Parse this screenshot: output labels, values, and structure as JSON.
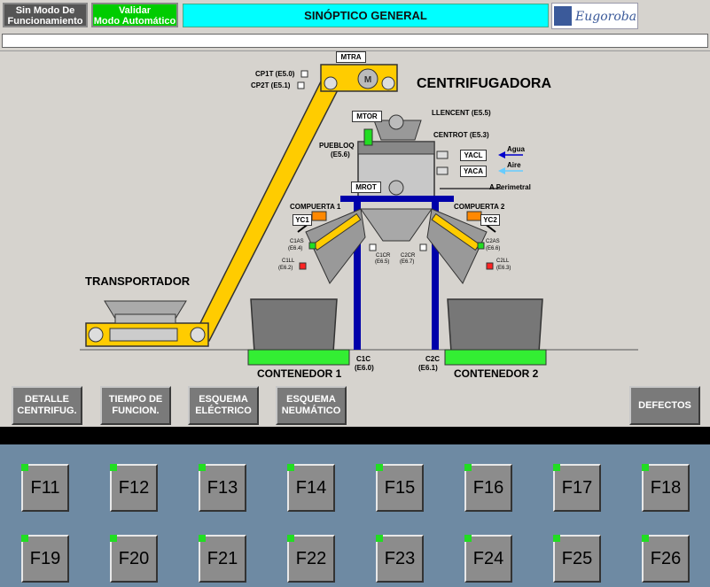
{
  "header": {
    "mode_button": "Sin Modo De\nFuncionamiento",
    "validate_button": "Validar\nModo Automático",
    "title": "SINÓPTICO GENERAL",
    "logo_text": "Eugoroba"
  },
  "synoptic": {
    "centrifuge_title": "CENTRIFUGADORA",
    "conveyor_title": "TRANSPORTADOR",
    "container1": "CONTENEDOR 1",
    "container2": "CONTENEDOR 2",
    "tags": {
      "mtra": "MTRA",
      "mtor": "MTOR",
      "mrot": "MROT",
      "yacl": "YACL",
      "yaca": "YACA",
      "yc1": "YC1",
      "yc2": "YC2",
      "motor_symbol": "M"
    },
    "signals": {
      "cp1t": "CP1T (E5.0)",
      "cp2t": "CP2T (E5.1)",
      "llencent": "LLENCENT (E5.5)",
      "centrot": "CENTROT (E5.3)",
      "puebloq": "PUEBLOQ",
      "puebloq_addr": "(E5.6)",
      "agua": "Agua",
      "aire": "Aire",
      "perimetral": "A Perimetral",
      "compuerta1": "COMPUERTA 1",
      "compuerta2": "COMPUERTA 2",
      "c1as": "C1AS",
      "c1as_addr": "(E6.4)",
      "c1ll": "C1LL",
      "c1ll_addr": "(E6.2)",
      "c1cr": "C1CR",
      "c1cr_addr": "(E6.5)",
      "c2cr": "C2CR",
      "c2cr_addr": "(E6.7)",
      "c2as": "C2AS",
      "c2as_addr": "(E6.6)",
      "c2ll": "C2LL",
      "c2ll_addr": "(E6.3)",
      "c1c": "C1C",
      "c1c_addr": "(E6.0)",
      "c2c": "C2C",
      "c2c_addr": "(E6.1)"
    }
  },
  "nav": {
    "detalle": "DETALLE\nCENTRIFUG.",
    "tiempo": "TIEMPO DE\nFUNCION.",
    "electrico": "ESQUEMA\nELÉCTRICO",
    "neumatico": "ESQUEMA\nNEUMÁTICO",
    "defectos": "DEFECTOS"
  },
  "function_keys": [
    "F11",
    "F12",
    "F13",
    "F14",
    "F15",
    "F16",
    "F17",
    "F18",
    "F19",
    "F20",
    "F21",
    "F22",
    "F23",
    "F24",
    "F25",
    "F26"
  ],
  "colors": {
    "title_bg": "#00ffff",
    "validate_bg": "#00cc00",
    "conveyor": "#ffcc00",
    "frame": "#0000aa",
    "container_base": "#33ee33",
    "fkey_panel": "#6e8aa3"
  }
}
